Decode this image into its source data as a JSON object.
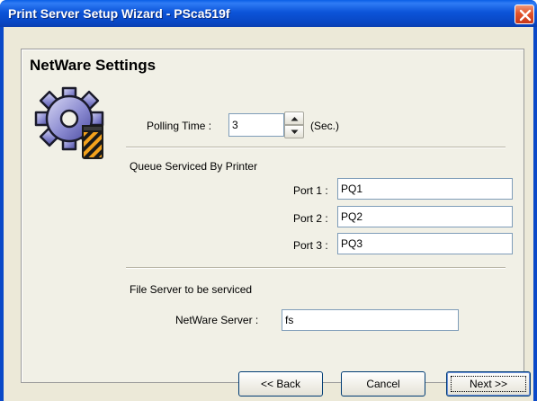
{
  "window": {
    "title": "Print Server Setup Wizard - PSca519f"
  },
  "page": {
    "heading": "NetWare Settings"
  },
  "polling": {
    "label": "Polling Time :",
    "value": "3",
    "unit": "(Sec.)"
  },
  "queue": {
    "section_label": "Queue Serviced By Printer",
    "ports": [
      {
        "label": "Port 1 :",
        "value": "PQ1"
      },
      {
        "label": "Port 2 :",
        "value": "PQ2"
      },
      {
        "label": "Port 3 :",
        "value": "PQ3"
      }
    ]
  },
  "file_server": {
    "section_label": "File Server to be serviced",
    "label": "NetWare Server :",
    "value": "fs"
  },
  "buttons": {
    "back": "<< Back",
    "cancel": "Cancel",
    "next": "Next >>"
  },
  "icons": {
    "close": "close-icon",
    "wizard": "gear-settings-icon",
    "spin_up": "arrow-up-icon",
    "spin_down": "arrow-down-icon"
  },
  "colors": {
    "titlebar": "#0a49c8",
    "close_button": "#e2532b",
    "dialog_background": "#ece9d8",
    "button_border": "#003c74"
  }
}
